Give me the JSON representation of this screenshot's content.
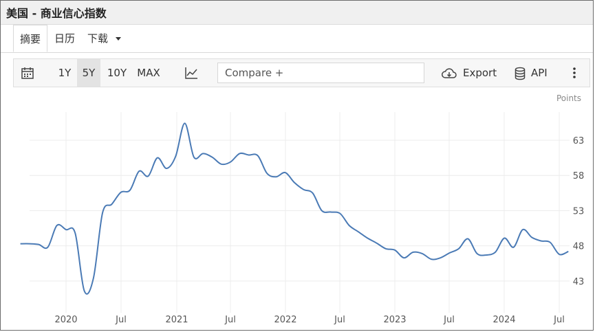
{
  "page": {
    "title": "美国 - 商业信心指数"
  },
  "tabs": [
    {
      "label": "摘要"
    },
    {
      "label": "日历"
    },
    {
      "label": "下载"
    }
  ],
  "toolbar": {
    "ranges": [
      {
        "label": "1Y"
      },
      {
        "label": "5Y"
      },
      {
        "label": "10Y"
      },
      {
        "label": "MAX"
      }
    ],
    "selected_range": "5Y",
    "compare_placeholder": "Compare +",
    "export_label": "Export",
    "api_label": "API"
  },
  "colors": {
    "line": "#4a7ab5",
    "grid": "#ececec",
    "axis_text": "#555555"
  },
  "chart_data": {
    "type": "line",
    "unit_label": "Points",
    "y_ticks": [
      43,
      48,
      53,
      58,
      63
    ],
    "x_tick_labels": [
      "2020",
      "Jul",
      "2021",
      "Jul",
      "2022",
      "Jul",
      "2023",
      "Jul",
      "2024",
      "Jul"
    ],
    "ylim": [
      38.5,
      67
    ],
    "grid": true,
    "series": [
      {
        "values": [
          {
            "x": "2019-08",
            "y": 48.3
          },
          {
            "x": "2019-09",
            "y": 48.3
          },
          {
            "x": "2019-10",
            "y": 48.2
          },
          {
            "x": "2019-11",
            "y": 47.8
          },
          {
            "x": "2019-12",
            "y": 50.9
          },
          {
            "x": "2020-01",
            "y": 50.3
          },
          {
            "x": "2020-02",
            "y": 49.8
          },
          {
            "x": "2020-03",
            "y": 41.6
          },
          {
            "x": "2020-04",
            "y": 43.4
          },
          {
            "x": "2020-05",
            "y": 52.7
          },
          {
            "x": "2020-06",
            "y": 53.9
          },
          {
            "x": "2020-07",
            "y": 55.6
          },
          {
            "x": "2020-08",
            "y": 55.9
          },
          {
            "x": "2020-09",
            "y": 58.6
          },
          {
            "x": "2020-10",
            "y": 57.9
          },
          {
            "x": "2020-11",
            "y": 60.5
          },
          {
            "x": "2020-12",
            "y": 59.0
          },
          {
            "x": "2021-01",
            "y": 60.7
          },
          {
            "x": "2021-02",
            "y": 65.4
          },
          {
            "x": "2021-03",
            "y": 60.6
          },
          {
            "x": "2021-04",
            "y": 61.1
          },
          {
            "x": "2021-05",
            "y": 60.6
          },
          {
            "x": "2021-06",
            "y": 59.6
          },
          {
            "x": "2021-07",
            "y": 59.9
          },
          {
            "x": "2021-08",
            "y": 61.1
          },
          {
            "x": "2021-09",
            "y": 60.9
          },
          {
            "x": "2021-10",
            "y": 60.8
          },
          {
            "x": "2021-11",
            "y": 58.3
          },
          {
            "x": "2021-12",
            "y": 57.8
          },
          {
            "x": "2022-01",
            "y": 58.4
          },
          {
            "x": "2022-02",
            "y": 57.0
          },
          {
            "x": "2022-03",
            "y": 56.0
          },
          {
            "x": "2022-04",
            "y": 55.5
          },
          {
            "x": "2022-05",
            "y": 53.0
          },
          {
            "x": "2022-06",
            "y": 52.8
          },
          {
            "x": "2022-07",
            "y": 52.6
          },
          {
            "x": "2022-08",
            "y": 50.9
          },
          {
            "x": "2022-09",
            "y": 50.0
          },
          {
            "x": "2022-10",
            "y": 49.1
          },
          {
            "x": "2022-11",
            "y": 48.4
          },
          {
            "x": "2022-12",
            "y": 47.6
          },
          {
            "x": "2023-01",
            "y": 47.4
          },
          {
            "x": "2023-02",
            "y": 46.3
          },
          {
            "x": "2023-03",
            "y": 47.1
          },
          {
            "x": "2023-04",
            "y": 46.9
          },
          {
            "x": "2023-05",
            "y": 46.1
          },
          {
            "x": "2023-06",
            "y": 46.3
          },
          {
            "x": "2023-07",
            "y": 47.0
          },
          {
            "x": "2023-08",
            "y": 47.6
          },
          {
            "x": "2023-09",
            "y": 49.0
          },
          {
            "x": "2023-10",
            "y": 46.9
          },
          {
            "x": "2023-11",
            "y": 46.7
          },
          {
            "x": "2023-12",
            "y": 47.1
          },
          {
            "x": "2024-01",
            "y": 49.1
          },
          {
            "x": "2024-02",
            "y": 47.8
          },
          {
            "x": "2024-03",
            "y": 50.3
          },
          {
            "x": "2024-04",
            "y": 49.2
          },
          {
            "x": "2024-05",
            "y": 48.7
          },
          {
            "x": "2024-06",
            "y": 48.5
          },
          {
            "x": "2024-07",
            "y": 46.8
          },
          {
            "x": "2024-08",
            "y": 47.2
          }
        ]
      }
    ]
  }
}
